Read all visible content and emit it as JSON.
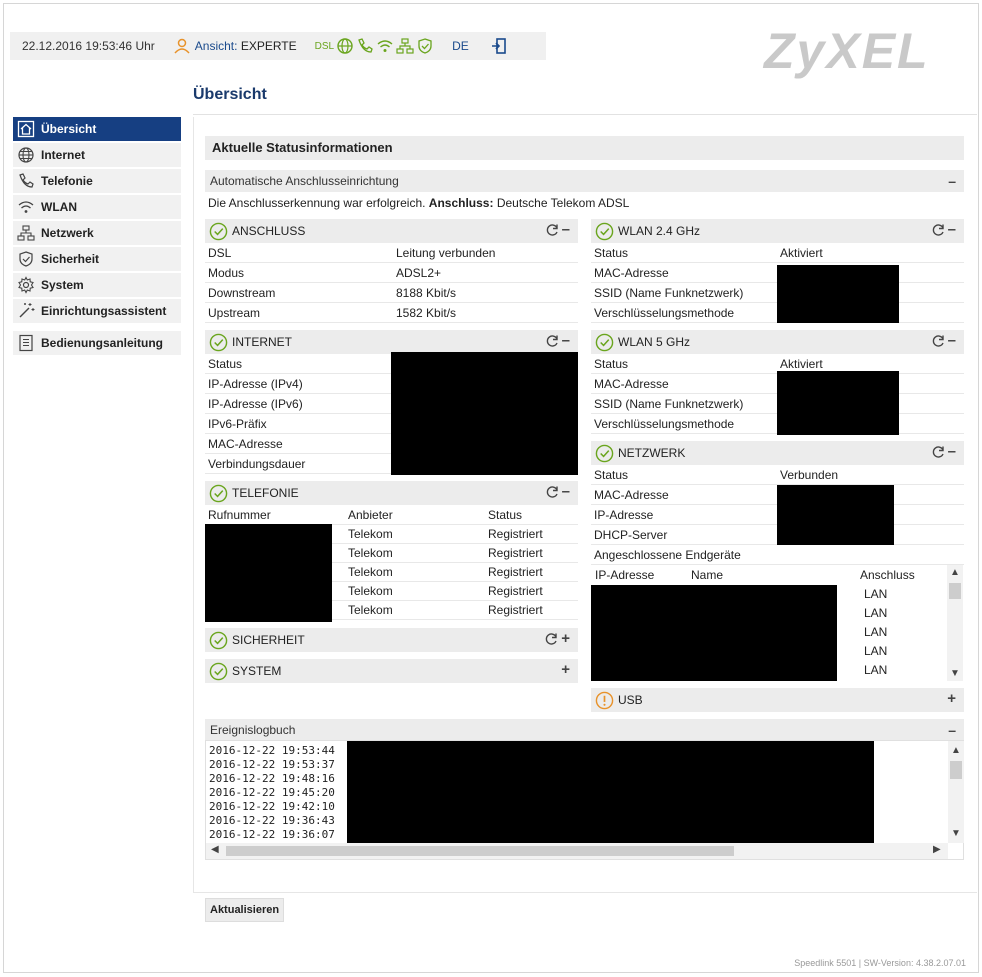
{
  "topbar": {
    "datetime": "22.12.2016 19:53:46 Uhr",
    "view_label": "Ansicht:",
    "view_value": "EXPERTE",
    "dsl_label": "DSL",
    "language": "DE"
  },
  "logo": "ZyXEL",
  "page_title": "Übersicht",
  "sidebar": {
    "items": [
      {
        "label": "Übersicht",
        "icon": "home-icon"
      },
      {
        "label": "Internet",
        "icon": "globe-icon"
      },
      {
        "label": "Telefonie",
        "icon": "phone-icon"
      },
      {
        "label": "WLAN",
        "icon": "wifi-icon"
      },
      {
        "label": "Netzwerk",
        "icon": "network-icon"
      },
      {
        "label": "Sicherheit",
        "icon": "shield-icon"
      },
      {
        "label": "System",
        "icon": "gear-icon"
      },
      {
        "label": "Einrichtungsassistent",
        "icon": "wand-icon"
      },
      {
        "label": "Bedienungsanleitung",
        "icon": "manual-icon"
      }
    ]
  },
  "status": {
    "heading": "Aktuelle Statusinformationen",
    "auto_setup": {
      "title": "Automatische Anschlusseinrichtung",
      "message": "Die Anschlusserkennung war erfolgreich.",
      "conn_label": "Anschluss:",
      "conn_value": "Deutsche Telekom ADSL"
    }
  },
  "anschluss": {
    "title": "ANSCHLUSS",
    "rows": [
      {
        "key": "DSL",
        "value": "Leitung verbunden"
      },
      {
        "key": "Modus",
        "value": "ADSL2+"
      },
      {
        "key": "Downstream",
        "value": "8188 Kbit/s"
      },
      {
        "key": "Upstream",
        "value": "1582 Kbit/s"
      }
    ]
  },
  "internet": {
    "title": "INTERNET",
    "rows": [
      "Status",
      "IP-Adresse (IPv4)",
      "IP-Adresse (IPv6)",
      "IPv6-Präfix",
      "MAC-Adresse",
      "Verbindungsdauer"
    ]
  },
  "telefonie": {
    "title": "TELEFONIE",
    "columns": [
      "Rufnummer",
      "Anbieter",
      "Status"
    ],
    "rows": [
      {
        "provider": "Telekom",
        "status": "Registriert"
      },
      {
        "provider": "Telekom",
        "status": "Registriert"
      },
      {
        "provider": "Telekom",
        "status": "Registriert"
      },
      {
        "provider": "Telekom",
        "status": "Registriert"
      },
      {
        "provider": "Telekom",
        "status": "Registriert"
      }
    ]
  },
  "sicherheit": {
    "title": "SICHERHEIT"
  },
  "system": {
    "title": "SYSTEM"
  },
  "wlan24": {
    "title": "WLAN 2.4 GHz",
    "rows": [
      {
        "key": "Status",
        "value": "Aktiviert"
      },
      {
        "key": "MAC-Adresse",
        "value": ""
      },
      {
        "key": "SSID (Name Funknetzwerk)",
        "value": ""
      },
      {
        "key": "Verschlüsselungsmethode",
        "value": ""
      }
    ]
  },
  "wlan5": {
    "title": "WLAN 5 GHz",
    "rows": [
      {
        "key": "Status",
        "value": "Aktiviert"
      },
      {
        "key": "MAC-Adresse",
        "value": ""
      },
      {
        "key": "SSID (Name Funknetzwerk)",
        "value": ""
      },
      {
        "key": "Verschlüsselungsmethode",
        "value": ""
      }
    ]
  },
  "netzwerk": {
    "title": "NETZWERK",
    "rows": [
      {
        "key": "Status",
        "value": "Verbunden"
      },
      {
        "key": "MAC-Adresse",
        "value": ""
      },
      {
        "key": "IP-Adresse",
        "value": ""
      },
      {
        "key": "DHCP-Server",
        "value": ""
      },
      {
        "key": "Angeschlossene Endgeräte",
        "value": ""
      }
    ],
    "device_columns": [
      "IP-Adresse",
      "Name",
      "Anschluss"
    ],
    "devices": [
      "LAN",
      "LAN",
      "LAN",
      "LAN",
      "LAN"
    ]
  },
  "usb": {
    "title": "USB"
  },
  "eventlog": {
    "title": "Ereignislogbuch",
    "entries": [
      "2016-12-22 19:53:44",
      "2016-12-22 19:53:37",
      "2016-12-22 19:48:16",
      "2016-12-22 19:45:20",
      "2016-12-22 19:42:10",
      "2016-12-22 19:36:43",
      "2016-12-22 19:36:07"
    ]
  },
  "refresh_button": "Aktualisieren",
  "footer": "Speedlink 5501 | SW-Version: 4.38.2.07.01",
  "colors": {
    "accent": "#163f82",
    "ok_green": "#6aa51e",
    "warn_orange": "#e8922a"
  }
}
